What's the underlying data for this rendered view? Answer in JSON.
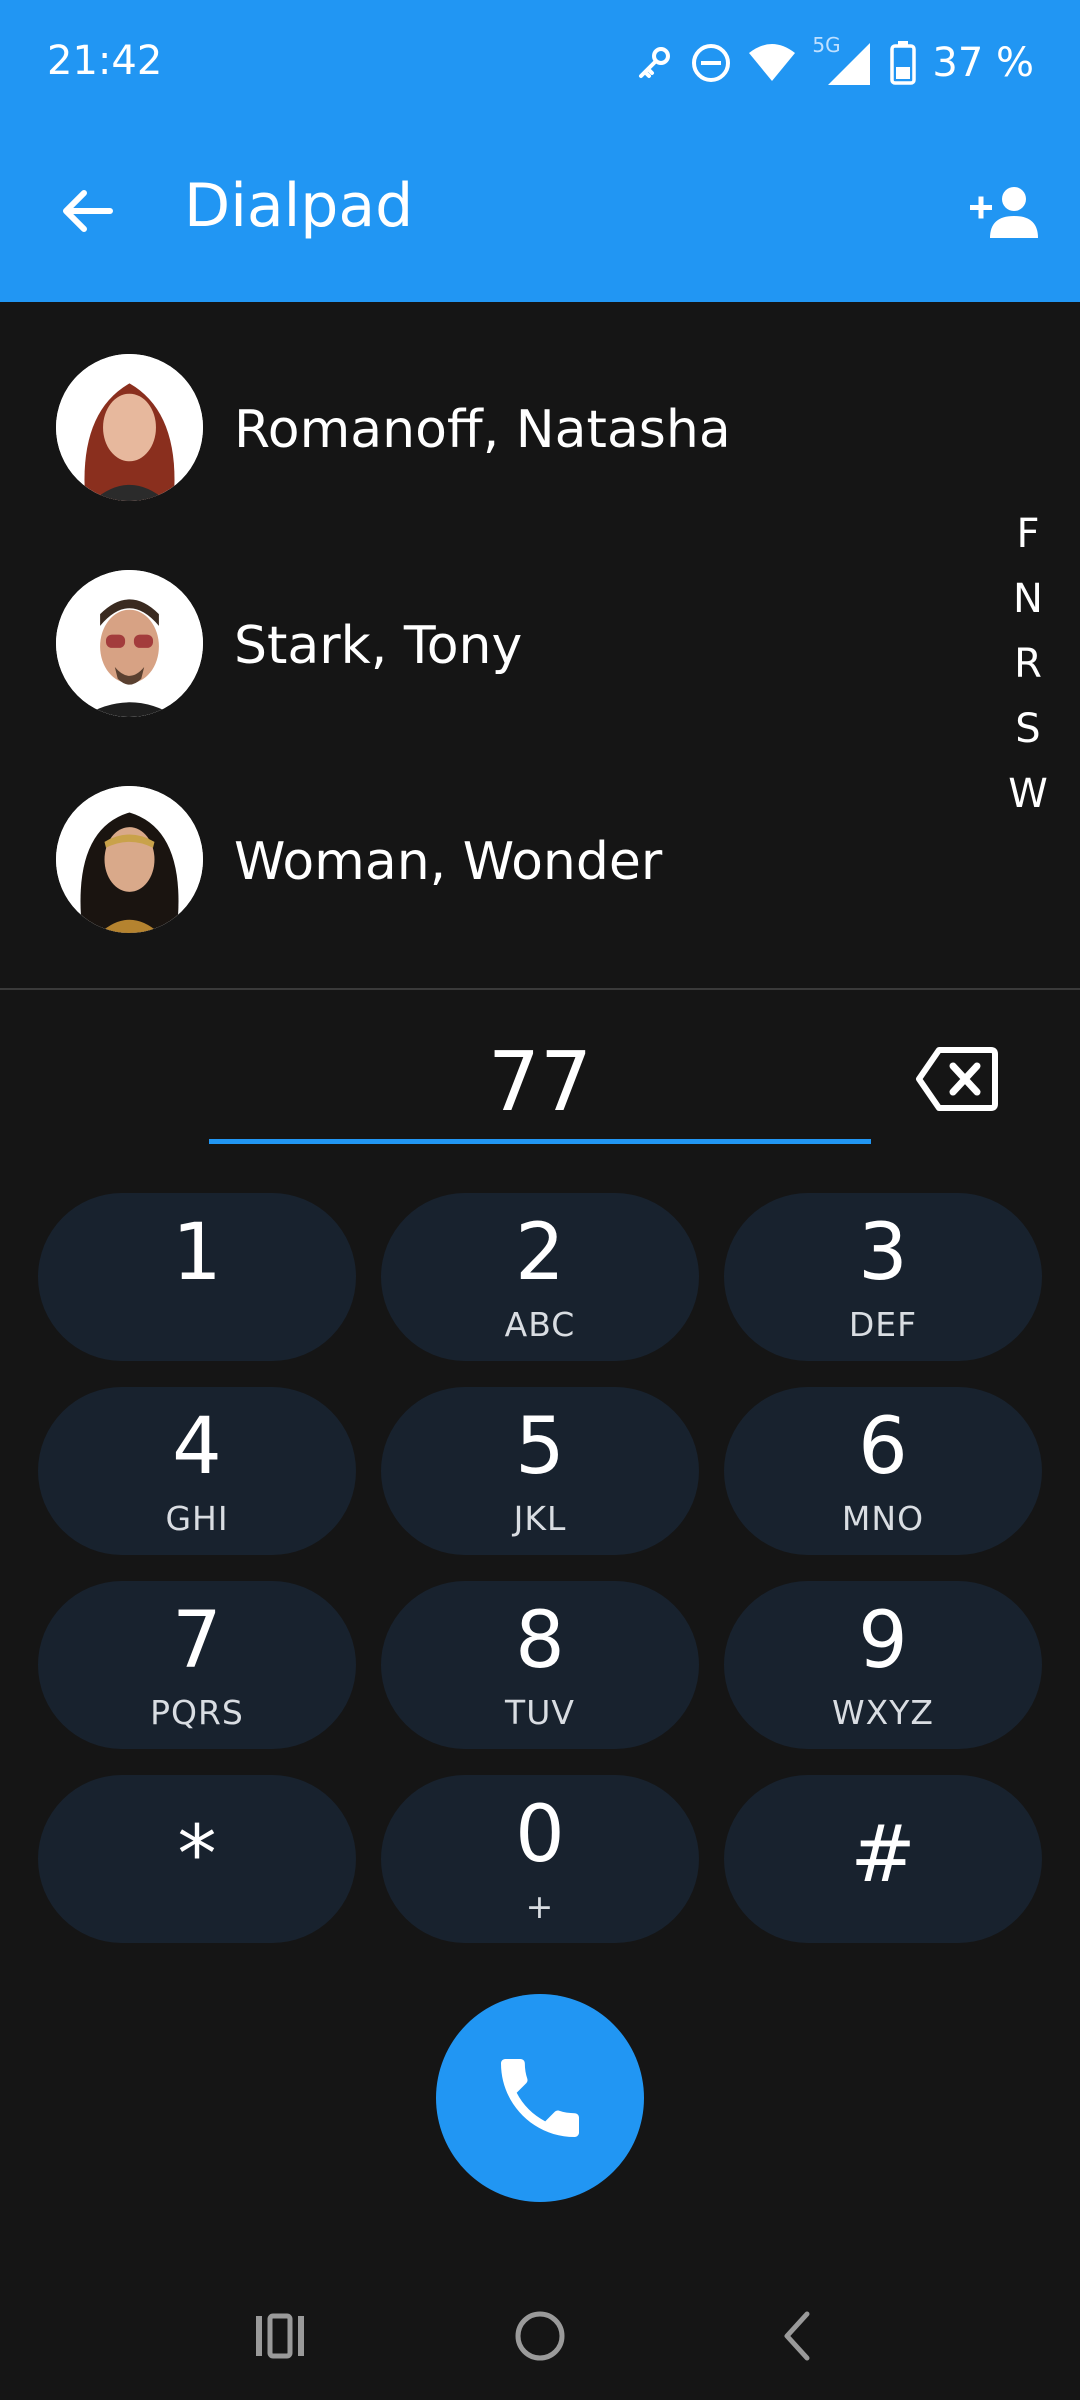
{
  "status": {
    "time": "21:42",
    "icons": [
      "key-icon",
      "do-not-disturb-icon",
      "wifi-icon",
      "signal-5g-icon",
      "battery-icon"
    ],
    "network_label": "5G",
    "battery": "37 %"
  },
  "appbar": {
    "title": "Dialpad",
    "back_icon": "arrow-back-icon",
    "add_contact_icon": "person-add-icon",
    "color": "#2196F3"
  },
  "contacts": [
    {
      "name": "Romanoff, Natasha"
    },
    {
      "name": "Stark, Tony"
    },
    {
      "name": "Woman, Wonder"
    }
  ],
  "alpha_index": [
    "F",
    "N",
    "R",
    "S",
    "W"
  ],
  "dial_input": {
    "value": "77",
    "backspace_icon": "backspace-icon"
  },
  "keypad": [
    {
      "digit": "1",
      "letters": ""
    },
    {
      "digit": "2",
      "letters": "ABC"
    },
    {
      "digit": "3",
      "letters": "DEF"
    },
    {
      "digit": "4",
      "letters": "GHI"
    },
    {
      "digit": "5",
      "letters": "JKL"
    },
    {
      "digit": "6",
      "letters": "MNO"
    },
    {
      "digit": "7",
      "letters": "PQRS"
    },
    {
      "digit": "8",
      "letters": "TUV"
    },
    {
      "digit": "9",
      "letters": "WXYZ"
    },
    {
      "digit": "*",
      "letters": ""
    },
    {
      "digit": "0",
      "letters": "+"
    },
    {
      "digit": "#",
      "letters": ""
    }
  ],
  "call_button": {
    "icon": "phone-icon",
    "color": "#2196F3"
  },
  "navbar": {
    "icons": [
      "recents-icon",
      "home-icon",
      "back-icon"
    ]
  }
}
